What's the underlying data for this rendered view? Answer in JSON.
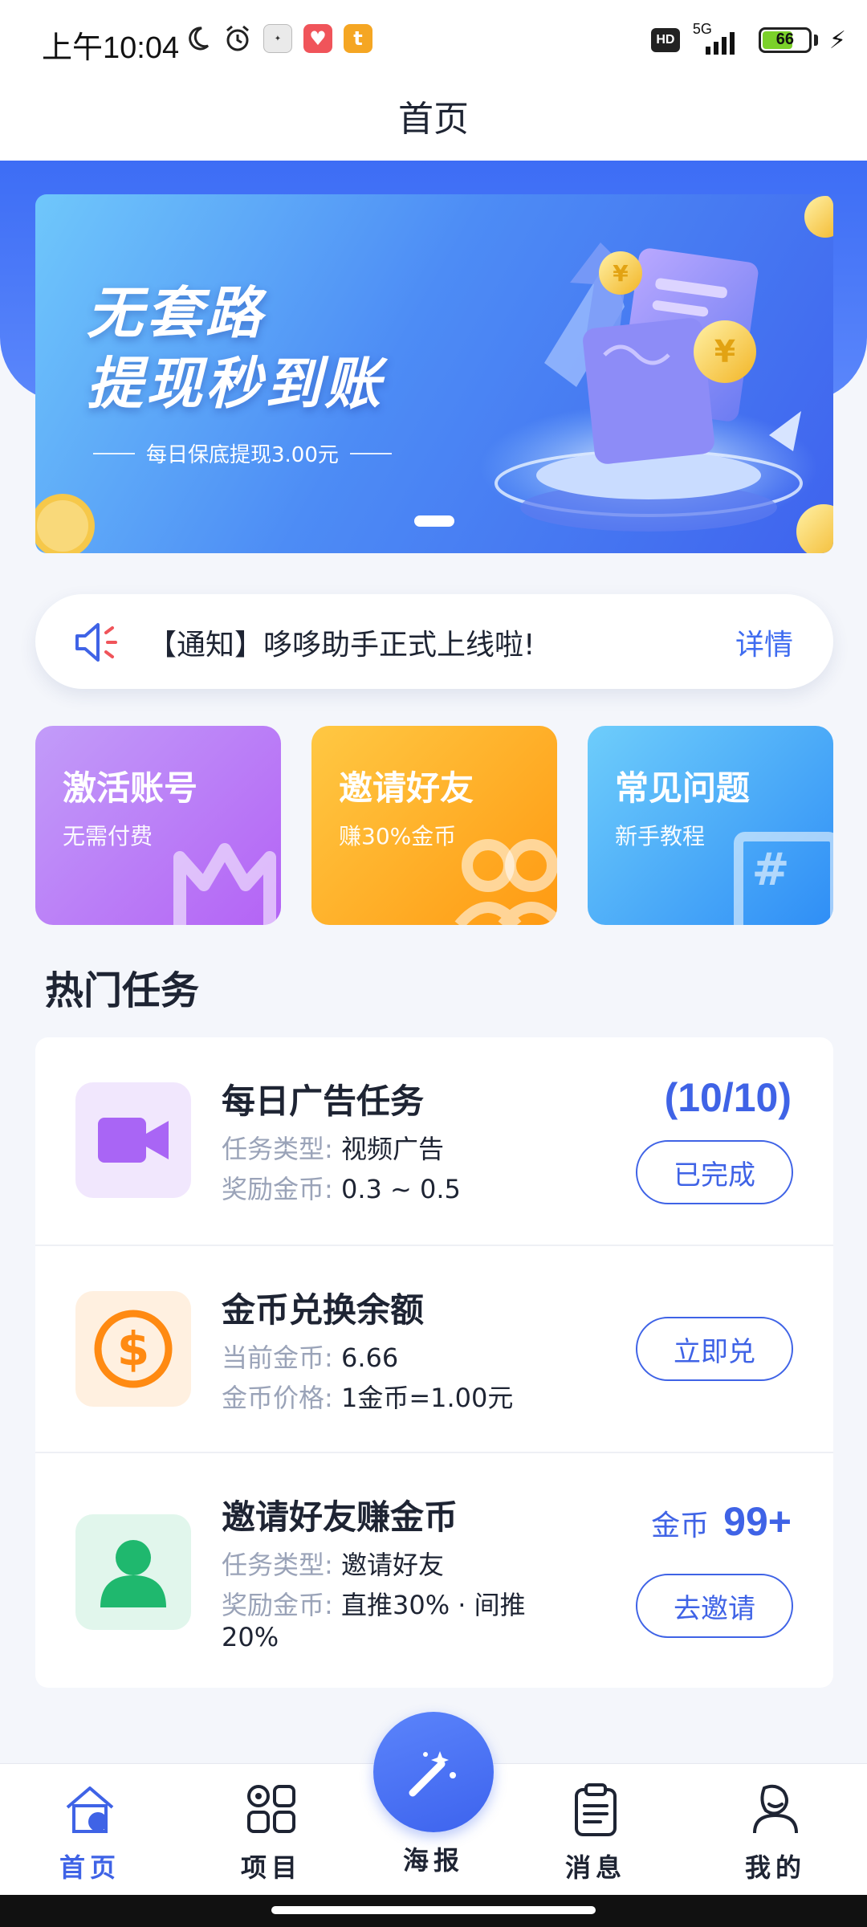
{
  "status_bar": {
    "time": "上午10:04",
    "network": "5G",
    "hd": "HD",
    "battery": "66",
    "battery_level": 0.66
  },
  "header": {
    "title": "首页"
  },
  "banner": {
    "line1": "无套路",
    "line2": "提现秒到账",
    "subtitle": "每日保底提现3.00元"
  },
  "notice": {
    "text": "【通知】哆哆助手正式上线啦!",
    "detail": "详情"
  },
  "quick_cards": [
    {
      "title": "激活账号",
      "subtitle": "无需付费"
    },
    {
      "title": "邀请好友",
      "subtitle": "赚30%金币"
    },
    {
      "title": "常见问题",
      "subtitle": "新手教程"
    }
  ],
  "hot_tasks": {
    "title": "热门任务",
    "items": [
      {
        "title": "每日广告任务",
        "line1_label": "任务类型:",
        "line1_value": "视频广告",
        "line2_label": "奖励金币:",
        "line2_value": "0.3 ~ 0.5",
        "count": "(10/10)",
        "button": "已完成",
        "icon": "video-icon"
      },
      {
        "title": "金币兑换余额",
        "line1_label": "当前金币:",
        "line1_value": "6.66",
        "line2_label": "金币价格:",
        "line2_value": "1金币=1.00元",
        "button": "立即兑",
        "icon": "dollar-icon"
      },
      {
        "title": "邀请好友赚金币",
        "line1_label": "任务类型:",
        "line1_value": "邀请好友",
        "line2_label": "奖励金币:",
        "line2_value": "直推30% · 间推",
        "line3_value": "20%",
        "coin_label": "金币",
        "coin_value": "99+",
        "button": "去邀请",
        "icon": "user-icon"
      }
    ]
  },
  "bottom_nav": {
    "items": [
      {
        "label": "首页",
        "icon": "home-icon"
      },
      {
        "label": "项目",
        "icon": "grid-icon"
      },
      {
        "label": "海报",
        "icon": "magic-wand-icon"
      },
      {
        "label": "消息",
        "icon": "clipboard-icon"
      },
      {
        "label": "我的",
        "icon": "profile-icon"
      }
    ]
  },
  "colors": {
    "primary": "#3f63e6",
    "banner_start": "#6fc7fb",
    "banner_end": "#3f63ee",
    "card_purple": "#b463f5",
    "card_orange": "#ff9a12",
    "card_blue": "#2f8ef6",
    "icon_purple": "#a965f5",
    "icon_orange": "#ff8a12",
    "icon_green": "#1fb86e"
  }
}
